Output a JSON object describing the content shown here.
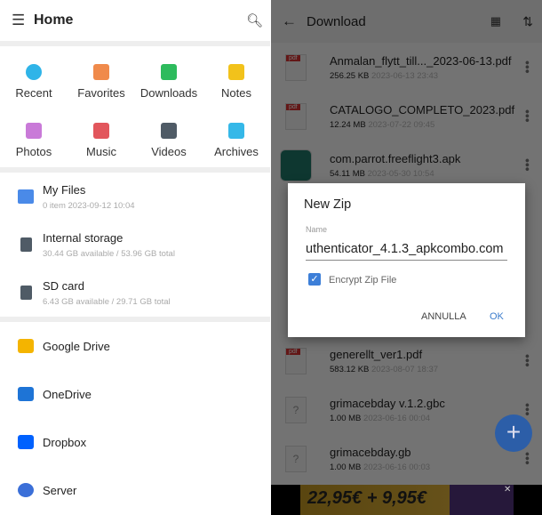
{
  "left": {
    "title": "Home",
    "quick": [
      {
        "label": "Recent",
        "icon": "clock-icon",
        "color": "#2fb4e8"
      },
      {
        "label": "Favorites",
        "icon": "star-icon",
        "color": "#f08a4b"
      },
      {
        "label": "Downloads",
        "icon": "download-icon",
        "color": "#2dbb5d"
      },
      {
        "label": "Notes",
        "icon": "pencil-icon",
        "color": "#f2c21b"
      },
      {
        "label": "Photos",
        "icon": "photo-icon",
        "color": "#c97ad8"
      },
      {
        "label": "Music",
        "icon": "music-icon",
        "color": "#e2565c"
      },
      {
        "label": "Videos",
        "icon": "video-icon",
        "color": "#4f5b66"
      },
      {
        "label": "Archives",
        "icon": "archive-icon",
        "color": "#35b8e8"
      }
    ],
    "storage": [
      {
        "name": "My Files",
        "sub": "0 item 2023-09-12 10:04"
      },
      {
        "name": "Internal storage",
        "sub": "30.44 GB available / 53.96 GB total"
      },
      {
        "name": "SD card",
        "sub": "6.43 GB available / 29.71 GB total"
      }
    ],
    "cloud": [
      {
        "name": "Google Drive"
      },
      {
        "name": "OneDrive"
      },
      {
        "name": "Dropbox"
      },
      {
        "name": "Server"
      }
    ]
  },
  "right": {
    "title": "Download",
    "files": [
      {
        "name": "Anmalan_flytt_till..._2023-06-13.pdf",
        "size": "256.25 KB",
        "date": "2023-06-13 23:43",
        "type": "pdf"
      },
      {
        "name": "CATALOGO_COMPLETO_2023.pdf",
        "size": "12.24 MB",
        "date": "2023-07-22 09:45",
        "type": "pdf"
      },
      {
        "name": "com.parrot.freeflight3.apk",
        "size": "54.11 MB",
        "date": "2023-05-30 10:54",
        "type": "apk"
      }
    ],
    "files2": [
      {
        "name": "generellt_ver1.pdf",
        "size": "583.12 KB",
        "date": "2023-08-07 18:37",
        "type": "pdf"
      },
      {
        "name": "grimacebday v.1.2.gbc",
        "size": "1.00 MB",
        "date": "2023-06-16 00:04",
        "type": "unknown"
      },
      {
        "name": "grimacebday.gb",
        "size": "1.00 MB",
        "date": "2023-06-16 00:03",
        "type": "unknown"
      }
    ],
    "ad": "22,95€ + 9,95€"
  },
  "dialog": {
    "title": "New Zip",
    "name_label": "Name",
    "name_value": "uthenticator_4.1.3_apkcombo.com",
    "encrypt_label": "Encrypt Zip File",
    "encrypt_checked": true,
    "cancel": "ANNULLA",
    "ok": "OK"
  }
}
